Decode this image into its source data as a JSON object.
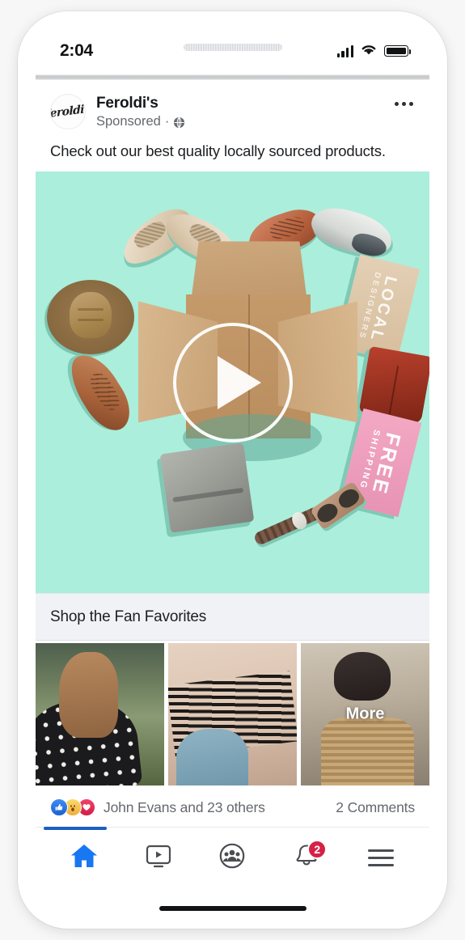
{
  "status_bar": {
    "time": "2:04",
    "signal_icon": "cellular-signal-icon",
    "wifi_icon": "wifi-icon",
    "battery_icon": "battery-full-icon"
  },
  "post": {
    "avatar_mark": "Feroldi's",
    "page_name": "Feroldi's",
    "sponsored_label": "Sponsored",
    "separator": "·",
    "privacy_icon": "globe-icon",
    "menu_icon": "more-options-icon",
    "body_text": "Check out our best quality locally sourced products."
  },
  "video": {
    "play_icon": "play-button-icon",
    "background_color": "#abeedb",
    "objects": {
      "local_card_text": "LOCAL",
      "local_card_subtext": "DESIGNERS",
      "free_card_text": "FREE",
      "free_card_subtext": "SHIPPING"
    }
  },
  "cta": {
    "title": "Shop the Fan Favorites"
  },
  "gallery": {
    "items": [
      {
        "name": "thumbnail-1",
        "label": ""
      },
      {
        "name": "thumbnail-2",
        "label": ""
      },
      {
        "name": "thumbnail-3",
        "label": "More"
      }
    ]
  },
  "reactions": {
    "icons": [
      "like-reaction-icon",
      "wow-reaction-icon",
      "love-reaction-icon"
    ],
    "like_glyph": "▲",
    "wow_glyph": "●",
    "love_glyph": "♥",
    "names_text": "John Evans and 23 others",
    "comments_text": "2 Comments"
  },
  "bottom_nav": {
    "items": [
      {
        "name": "nav-home",
        "icon": "home-icon",
        "active": true,
        "badge": ""
      },
      {
        "name": "nav-watch",
        "icon": "video-watch-icon",
        "active": false,
        "badge": ""
      },
      {
        "name": "nav-groups",
        "icon": "groups-icon",
        "active": false,
        "badge": ""
      },
      {
        "name": "nav-notifications",
        "icon": "bell-icon",
        "active": false,
        "badge": "2"
      },
      {
        "name": "nav-menu",
        "icon": "hamburger-menu-icon",
        "active": false,
        "badge": ""
      }
    ],
    "notification_badge": "2"
  },
  "colors": {
    "accent_blue": "#1b5fc1",
    "badge_red": "#d62146",
    "mint": "#abeedb",
    "cta_bg": "#f0f2f5"
  }
}
